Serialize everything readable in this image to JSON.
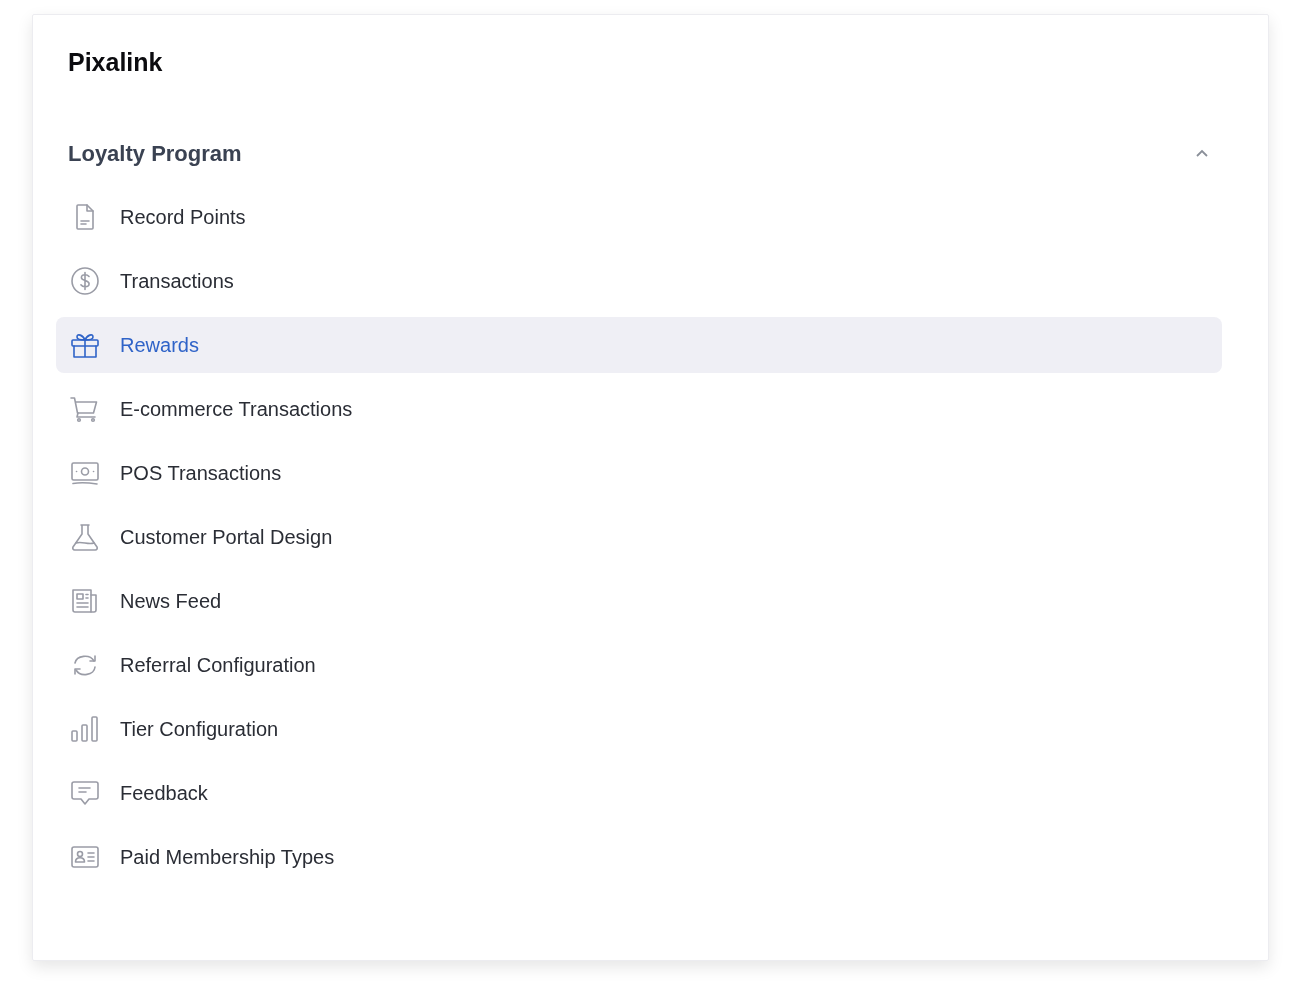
{
  "app": {
    "title": "Pixalink"
  },
  "section": {
    "title": "Loyalty Program",
    "expanded": true
  },
  "items": [
    {
      "label": "Record Points",
      "kind": "document",
      "selected": false
    },
    {
      "label": "Transactions",
      "kind": "dollar",
      "selected": false
    },
    {
      "label": "Rewards",
      "kind": "gift",
      "selected": true
    },
    {
      "label": "E-commerce Transactions",
      "kind": "cart",
      "selected": false
    },
    {
      "label": "POS Transactions",
      "kind": "cash",
      "selected": false
    },
    {
      "label": "Customer Portal Design",
      "kind": "flask",
      "selected": false
    },
    {
      "label": "News Feed",
      "kind": "newspaper",
      "selected": false
    },
    {
      "label": "Referral Configuration",
      "kind": "refresh",
      "selected": false
    },
    {
      "label": "Tier Configuration",
      "kind": "bars",
      "selected": false
    },
    {
      "label": "Feedback",
      "kind": "chat",
      "selected": false
    },
    {
      "label": "Paid Membership Types",
      "kind": "idcard",
      "selected": false
    }
  ]
}
